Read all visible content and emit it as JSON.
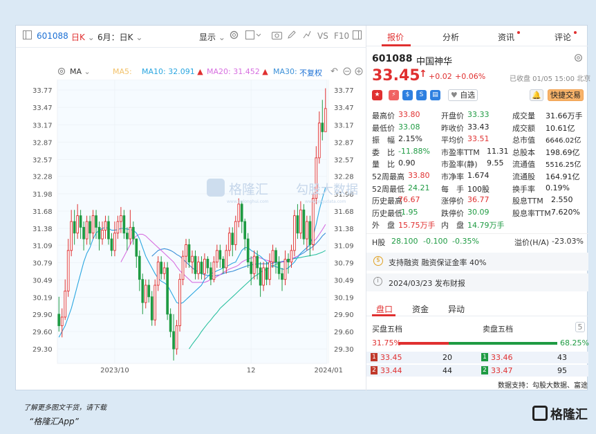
{
  "toolbar": {
    "code": "601088",
    "period": "日K",
    "range": "6月：日K",
    "display": "显示",
    "vs": "VS",
    "f10": "F10"
  },
  "ma": {
    "label": "MA",
    "ma5": "MA5:",
    "ma10_label": "MA10:",
    "ma10_val": "32.091",
    "ma20_label": "MA20:",
    "ma20_val": "31.452",
    "ma30_label": "MA30:",
    "adjust": "不复权"
  },
  "tabs": [
    "报价",
    "分析",
    "资讯",
    "评论"
  ],
  "stock": {
    "code": "601088",
    "name": "中国神华",
    "price": "33.45",
    "change": "+0.02",
    "pct": "+0.06%",
    "status": "已收盘 01/05 15:00 北京",
    "watch": "自选",
    "trade": "快捷交易"
  },
  "quote_rows": [
    [
      [
        "最高价",
        "33.80",
        "red"
      ],
      [
        "开盘价",
        "33.33",
        "green"
      ],
      [
        "成交量",
        "31.66万手",
        "dark"
      ]
    ],
    [
      [
        "最低价",
        "33.08",
        "green"
      ],
      [
        "昨收价",
        "33.43",
        "dark"
      ],
      [
        "成交额",
        "10.61亿",
        "dark"
      ]
    ],
    [
      [
        "振　幅",
        "2.15%",
        "dark"
      ],
      [
        "平均价",
        "33.51",
        "red"
      ],
      [
        "总市值",
        "6646.02亿",
        "dark"
      ]
    ],
    [
      [
        "委　比",
        "-11.88%",
        "green"
      ],
      [
        "市盈率TTM",
        "11.31",
        "dark"
      ],
      [
        "总股本",
        "198.69亿",
        "dark"
      ]
    ],
    [
      [
        "量　比",
        "0.90",
        "dark"
      ],
      [
        "市盈率(静)",
        "9.55",
        "dark"
      ],
      [
        "流通值",
        "5516.25亿",
        "dark"
      ]
    ],
    [
      [
        "52周最高",
        "33.80",
        "red"
      ],
      [
        "市净率",
        "1.674",
        "dark"
      ],
      [
        "流通股",
        "164.91亿",
        "dark"
      ]
    ],
    [
      [
        "52周最低",
        "24.21",
        "green"
      ],
      [
        "每　手",
        "100股",
        "dark"
      ],
      [
        "换手率",
        "0.19%",
        "dark"
      ]
    ],
    [
      [
        "历史最高",
        "76.67",
        "red"
      ],
      [
        "涨停价",
        "36.77",
        "red"
      ],
      [
        "股息TTM",
        "2.550",
        "dark"
      ]
    ],
    [
      [
        "历史最低",
        "-1.95",
        "green"
      ],
      [
        "跌停价",
        "30.09",
        "green"
      ],
      [
        "股息率TTM",
        "7.620%",
        "dark"
      ]
    ],
    [
      [
        "外　盘",
        "15.75万手",
        "red"
      ],
      [
        "内　盘",
        "14.79万手",
        "green"
      ]
    ]
  ],
  "hshare": {
    "label": "H股",
    "price": "28.100",
    "chg": "-0.100",
    "pct": "-0.35%",
    "premium_label": "溢价(H/A)",
    "premium": "-23.03%"
  },
  "margin": "支持融资 融资保证金率 40%",
  "report": "2024/03/23  发布财报",
  "subtabs": [
    "盘口",
    "资金",
    "异动"
  ],
  "depth": {
    "buy_title": "买盘五档",
    "sell_title": "卖盘五档",
    "buy_pct": "31.75%",
    "sell_pct": "68.25%",
    "buy_ratio": 0.3175,
    "rows": [
      {
        "bi": "1",
        "bp": "33.45",
        "bv": "20",
        "si": "1",
        "sp": "33.46",
        "sv": "43"
      },
      {
        "bi": "2",
        "bp": "33.44",
        "bv": "44",
        "si": "2",
        "sp": "33.47",
        "sv": "95"
      }
    ],
    "page_btn": "5"
  },
  "source": "数据支持：勾股大数据、富途",
  "footer": {
    "line1": "了解更多图文干货，请下载",
    "line2": "“格隆汇App”",
    "brand": "格隆汇"
  },
  "watermark": {
    "brand": "格隆汇",
    "brand_url": "www.gelonghui.com",
    "partner": "勾股大数据",
    "partner_url": "www.gogudata.com"
  },
  "colors": {
    "up": "#e03030",
    "down": "#1f9b43",
    "ma10": "#2aa6e0",
    "ma20": "#d76fe0",
    "ma30": "#3a8fd8",
    "ma60": "#2ac0a0"
  },
  "chart_data": {
    "type": "candlestick",
    "y_ticks": [
      "33.77",
      "33.47",
      "33.17",
      "32.87",
      "32.57",
      "32.28",
      "31.98",
      "31.68",
      "31.38",
      "31.09",
      "30.79",
      "30.49",
      "30.19",
      "29.90",
      "29.60",
      "29.30"
    ],
    "ylim": [
      29.05,
      33.95
    ],
    "x_labels": [
      "2023/10",
      "12",
      "2024/01"
    ],
    "x_label_index": [
      18,
      62,
      87
    ],
    "candles": [
      [
        29.9,
        29.7,
        30.2,
        29.6
      ],
      [
        29.7,
        29.85,
        30.0,
        29.5
      ],
      [
        29.85,
        30.3,
        30.5,
        29.8
      ],
      [
        30.3,
        31.0,
        31.2,
        30.2
      ],
      [
        31.0,
        31.5,
        31.7,
        30.9
      ],
      [
        31.5,
        31.3,
        31.7,
        31.1
      ],
      [
        31.3,
        31.6,
        31.8,
        31.2
      ],
      [
        31.6,
        31.4,
        31.7,
        31.2
      ],
      [
        31.4,
        31.2,
        31.5,
        31.0
      ],
      [
        31.2,
        31.5,
        31.6,
        31.1
      ],
      [
        31.5,
        31.3,
        31.6,
        31.1
      ],
      [
        31.3,
        31.6,
        31.7,
        31.2
      ],
      [
        31.6,
        31.4,
        31.7,
        31.2
      ],
      [
        31.4,
        31.2,
        31.5,
        31.0
      ],
      [
        31.2,
        31.35,
        31.5,
        31.1
      ],
      [
        31.35,
        31.5,
        31.6,
        31.2
      ],
      [
        31.5,
        31.2,
        31.6,
        31.1
      ],
      [
        31.2,
        31.0,
        31.3,
        30.9
      ],
      [
        31.0,
        31.3,
        31.5,
        30.9
      ],
      [
        31.3,
        31.5,
        31.6,
        31.2
      ],
      [
        31.5,
        31.6,
        31.75,
        31.3
      ],
      [
        31.6,
        31.3,
        31.7,
        31.2
      ],
      [
        31.3,
        31.2,
        31.4,
        31.0
      ],
      [
        31.2,
        31.4,
        31.7,
        31.1
      ],
      [
        31.4,
        31.2,
        31.5,
        31.1
      ],
      [
        31.2,
        30.9,
        31.2,
        30.7
      ],
      [
        30.9,
        30.5,
        31.0,
        30.3
      ],
      [
        30.5,
        30.1,
        30.6,
        29.9
      ],
      [
        30.1,
        30.4,
        30.5,
        30.0
      ],
      [
        30.4,
        30.2,
        30.5,
        30.1
      ],
      [
        30.2,
        29.8,
        30.3,
        29.7
      ],
      [
        29.8,
        30.4,
        30.5,
        29.7
      ],
      [
        30.4,
        30.8,
        30.9,
        30.3
      ],
      [
        30.8,
        30.6,
        30.9,
        30.5
      ],
      [
        30.6,
        30.7,
        30.8,
        30.5
      ],
      [
        30.7,
        29.9,
        30.8,
        29.8
      ],
      [
        29.9,
        29.6,
        30.0,
        29.5
      ],
      [
        29.6,
        29.3,
        29.9,
        29.1
      ],
      [
        29.3,
        29.7,
        29.8,
        29.2
      ],
      [
        29.7,
        30.5,
        30.6,
        29.6
      ],
      [
        30.5,
        30.9,
        31.0,
        30.4
      ],
      [
        30.9,
        31.1,
        31.2,
        30.7
      ],
      [
        31.1,
        30.8,
        31.2,
        30.7
      ],
      [
        30.8,
        30.9,
        31.0,
        30.6
      ],
      [
        30.9,
        30.6,
        31.0,
        30.5
      ],
      [
        30.6,
        30.8,
        30.9,
        30.5
      ],
      [
        30.8,
        30.6,
        30.9,
        30.5
      ],
      [
        30.6,
        30.85,
        30.95,
        30.5
      ],
      [
        30.85,
        30.7,
        30.9,
        30.6
      ],
      [
        30.7,
        30.5,
        30.8,
        30.4
      ],
      [
        30.5,
        30.8,
        30.9,
        30.45
      ],
      [
        30.8,
        31.0,
        31.1,
        30.7
      ],
      [
        31.0,
        30.85,
        31.1,
        30.7
      ],
      [
        30.85,
        30.7,
        30.9,
        30.6
      ],
      [
        30.7,
        31.0,
        31.1,
        30.6
      ],
      [
        31.0,
        31.3,
        31.4,
        30.9
      ],
      [
        31.3,
        31.1,
        31.4,
        30.9
      ],
      [
        31.1,
        31.5,
        31.6,
        31.0
      ],
      [
        31.5,
        31.8,
        31.9,
        31.4
      ],
      [
        31.8,
        31.5,
        31.85,
        31.3
      ],
      [
        31.5,
        31.2,
        31.55,
        31.0
      ],
      [
        31.2,
        30.8,
        31.3,
        30.7
      ],
      [
        30.8,
        30.6,
        30.9,
        30.4
      ],
      [
        30.6,
        30.9,
        31.0,
        30.5
      ],
      [
        30.9,
        30.7,
        31.0,
        30.5
      ],
      [
        30.7,
        30.4,
        30.8,
        30.2
      ],
      [
        30.4,
        30.7,
        30.8,
        30.3
      ],
      [
        30.7,
        30.5,
        30.8,
        30.4
      ],
      [
        30.5,
        30.8,
        30.95,
        30.4
      ],
      [
        30.8,
        31.0,
        31.1,
        30.7
      ],
      [
        31.0,
        30.8,
        31.05,
        30.6
      ],
      [
        30.8,
        30.6,
        30.9,
        30.5
      ],
      [
        30.6,
        30.5,
        30.7,
        30.3
      ],
      [
        30.5,
        30.85,
        31.0,
        30.4
      ],
      [
        30.85,
        30.8,
        30.95,
        30.6
      ],
      [
        30.8,
        31.0,
        31.1,
        30.7
      ],
      [
        31.0,
        31.6,
        31.7,
        30.9
      ],
      [
        31.6,
        31.3,
        31.8,
        31.2
      ],
      [
        31.3,
        31.7,
        31.85,
        31.2
      ],
      [
        31.7,
        31.2,
        31.8,
        31.1
      ],
      [
        31.2,
        31.5,
        31.6,
        31.0
      ],
      [
        31.5,
        31.1,
        31.6,
        30.9
      ],
      [
        31.1,
        31.9,
        32.0,
        31.0
      ],
      [
        31.9,
        32.6,
        32.8,
        31.8
      ],
      [
        32.6,
        33.2,
        33.4,
        32.5
      ],
      [
        33.2,
        33.05,
        33.6,
        32.9
      ],
      [
        33.05,
        33.45,
        33.8,
        33.08
      ]
    ],
    "ma10": [
      29.5,
      29.6,
      29.7,
      29.85,
      30.0,
      30.2,
      30.4,
      30.6,
      30.8,
      30.95,
      31.05,
      31.2,
      31.3,
      31.35,
      31.38,
      31.4,
      31.38,
      31.35,
      31.35,
      31.36,
      31.38,
      31.38,
      31.37,
      31.36,
      31.35,
      31.3,
      31.2,
      31.05,
      30.9,
      30.8,
      30.7,
      30.6,
      30.52,
      30.47,
      30.44,
      30.4,
      30.3,
      30.2,
      30.1,
      30.08,
      30.1,
      30.15,
      30.2,
      30.25,
      30.3,
      30.35,
      30.4,
      30.5,
      30.55,
      30.6,
      30.62,
      30.65,
      30.67,
      30.7,
      30.72,
      30.75,
      30.78,
      30.8,
      30.9,
      31.0,
      31.05,
      31.05,
      31.0,
      30.97,
      30.93,
      30.9,
      30.85,
      30.8,
      30.76,
      30.73,
      30.72,
      30.7,
      30.68,
      30.67,
      30.7,
      30.75,
      30.8,
      30.88,
      30.95,
      31.0,
      31.05,
      31.1,
      31.25,
      31.45,
      31.7,
      31.9,
      32.09
    ],
    "ma20": [
      null,
      null,
      null,
      null,
      null,
      null,
      null,
      null,
      null,
      null,
      null,
      null,
      null,
      null,
      null,
      null,
      null,
      null,
      null,
      null,
      30.8,
      30.9,
      31.0,
      31.1,
      31.2,
      31.25,
      31.28,
      31.28,
      31.25,
      31.2,
      31.15,
      31.1,
      31.05,
      31.0,
      30.95,
      30.9,
      30.85,
      30.8,
      30.72,
      30.65,
      30.6,
      30.55,
      30.5,
      30.45,
      30.45,
      30.45,
      30.45,
      30.45,
      30.47,
      30.5,
      30.52,
      30.55,
      30.58,
      30.62,
      30.65,
      30.68,
      30.7,
      30.72,
      30.75,
      30.8,
      30.83,
      30.85,
      30.87,
      30.88,
      30.88,
      30.87,
      30.85,
      30.83,
      30.82,
      30.8,
      30.8,
      30.8,
      30.8,
      30.8,
      30.82,
      30.85,
      30.88,
      30.9,
      30.95,
      31.0,
      31.05,
      31.1,
      31.15,
      31.2,
      31.28,
      31.36,
      31.45
    ],
    "ma30": [
      null,
      null,
      null,
      null,
      null,
      null,
      null,
      null,
      null,
      null,
      null,
      null,
      null,
      null,
      null,
      null,
      null,
      null,
      null,
      null,
      null,
      null,
      null,
      null,
      null,
      null,
      null,
      null,
      null,
      null,
      30.9,
      30.95,
      31.0,
      31.02,
      31.03,
      31.02,
      31.0,
      30.97,
      30.93,
      30.9,
      30.85,
      30.8,
      30.75,
      30.7,
      30.66,
      30.63,
      30.6,
      30.58,
      30.57,
      30.56,
      30.56,
      30.57,
      30.58,
      30.6,
      30.62,
      30.63,
      30.64,
      30.66,
      30.68,
      30.7,
      30.72,
      30.74,
      30.75,
      30.76,
      30.77,
      30.77,
      30.77,
      30.77,
      30.77,
      30.78,
      30.79,
      30.8,
      30.81,
      30.82,
      30.83,
      30.85,
      30.87,
      30.9,
      30.93,
      30.96,
      31.0,
      31.03,
      31.07,
      31.12,
      31.18,
      31.25,
      31.3
    ],
    "ma60": [
      null,
      null,
      null,
      null,
      null,
      null,
      null,
      null,
      null,
      null,
      null,
      null,
      null,
      null,
      null,
      null,
      null,
      null,
      null,
      null,
      null,
      null,
      null,
      null,
      null,
      null,
      null,
      null,
      null,
      null,
      null,
      null,
      null,
      null,
      null,
      null,
      null,
      null,
      null,
      null,
      null,
      null,
      29.3,
      29.38,
      29.45,
      29.52,
      29.6,
      29.67,
      29.74,
      29.8,
      29.87,
      29.93,
      30.0,
      30.05,
      30.1,
      30.15,
      30.2,
      30.25,
      30.3,
      30.35,
      30.4,
      30.45,
      30.5,
      30.55,
      30.58,
      30.62,
      30.65,
      30.68,
      30.7,
      30.73,
      30.76,
      30.78,
      30.8,
      30.82,
      30.84,
      30.85,
      30.86,
      30.87,
      30.88,
      30.89,
      30.9,
      30.91,
      30.92,
      30.93,
      30.95,
      30.97,
      31.0
    ]
  }
}
